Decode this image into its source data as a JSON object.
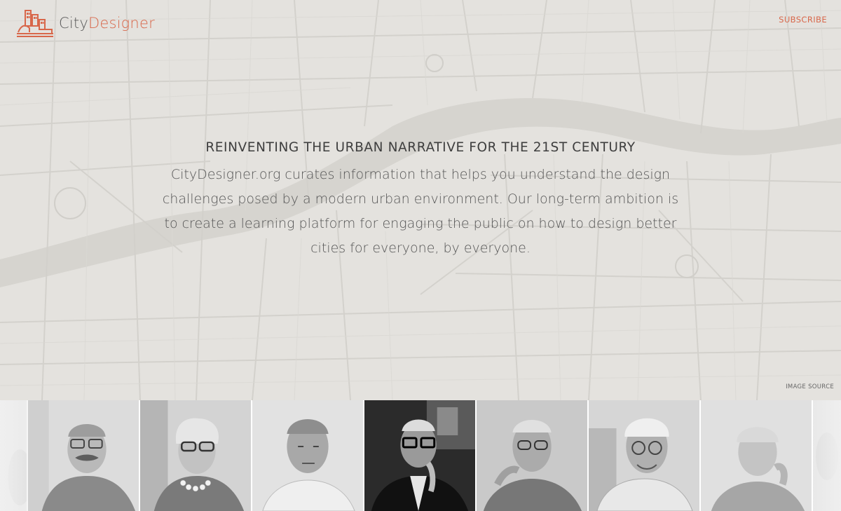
{
  "header": {
    "logo_city": "City",
    "logo_designer": "Designer",
    "subscribe_label": "SUBSCRIBE"
  },
  "intro": {
    "title": "REINVENTING THE URBAN NARRATIVE FOR THE 21ST CENTURY",
    "body": "CityDesigner.org curates information that helps you understand the design challenges posed by a modern urban environment. Our long-term ambition is to create a learning platform for engaging the public on how to design better cities for everyone, by everyone."
  },
  "image_source_label": "IMAGE SOURCE",
  "colors": {
    "accent": "#d8674a",
    "map_background": "#e4e2de",
    "title_text": "#3e3e3e",
    "body_text": "#555555"
  },
  "portraits": [
    {
      "tone": "#dcdcdc"
    },
    {
      "tone": "#d3d3d3"
    },
    {
      "tone": "#cfcfcf"
    },
    {
      "tone": "#dadada"
    },
    {
      "tone": "#2b2b2b"
    },
    {
      "tone": "#c9c9c9"
    },
    {
      "tone": "#d6d6d6"
    },
    {
      "tone": "#e0e0e0"
    },
    {
      "tone": "#dddddd"
    }
  ]
}
